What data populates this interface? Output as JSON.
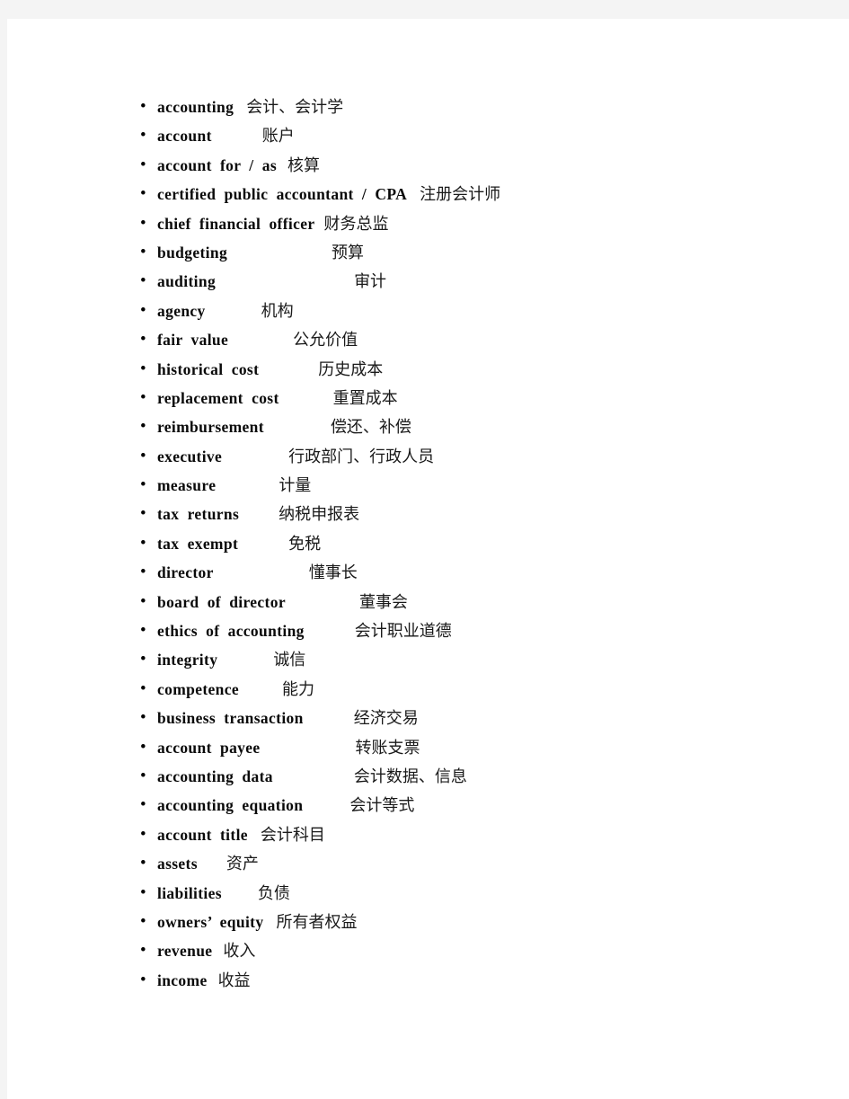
{
  "page": {
    "background_color": "#f4f4f4",
    "sheet_color": "#ffffff",
    "bullet_glyph": "•"
  },
  "glossary": {
    "items": [
      {
        "en": "accounting",
        "zh": "会计、会计学",
        "gap": 14
      },
      {
        "en": "account",
        "zh": "账户",
        "gap": 56
      },
      {
        "en": "account for / as",
        "zh": "核算",
        "gap": 12
      },
      {
        "en": "certified public accountant / CPA",
        "zh": "注册会计师",
        "gap": 14
      },
      {
        "en": "chief financial officer",
        "zh": "财务总监",
        "gap": 10
      },
      {
        "en": "budgeting",
        "zh": "预算",
        "gap": 116
      },
      {
        "en": "auditing",
        "zh": "审计",
        "gap": 154
      },
      {
        "en": "agency",
        "zh": "机构",
        "gap": 62
      },
      {
        "en": "fair value",
        "zh": "公允价值",
        "gap": 72
      },
      {
        "en": "historical cost",
        "zh": "历史成本",
        "gap": 66
      },
      {
        "en": "replacement cost",
        "zh": "重置成本",
        "gap": 60
      },
      {
        "en": "reimbursement",
        "zh": "偿还、补偿",
        "gap": 74
      },
      {
        "en": "executive",
        "zh": "行政部门、行政人员",
        "gap": 74
      },
      {
        "en": "measure",
        "zh": "计量",
        "gap": 70
      },
      {
        "en": "tax returns",
        "zh": "纳税申报表",
        "gap": 44
      },
      {
        "en": "tax exempt",
        "zh": "免税",
        "gap": 56
      },
      {
        "en": "director",
        "zh": "懂事长",
        "gap": 106
      },
      {
        "en": "board of director",
        "zh": "董事会",
        "gap": 82
      },
      {
        "en": "ethics of accounting",
        "zh": "会计职业道德",
        "gap": 56
      },
      {
        "en": "integrity",
        "zh": "诚信",
        "gap": 62
      },
      {
        "en": "competence",
        "zh": "能力",
        "gap": 48
      },
      {
        "en": "business transaction",
        "zh": "经济交易",
        "gap": 56
      },
      {
        "en": "account payee",
        "zh": "转账支票",
        "gap": 106
      },
      {
        "en": "accounting data",
        "zh": "会计数据、信息",
        "gap": 90
      },
      {
        "en": "accounting equation",
        "zh": "会计等式",
        "gap": 52
      },
      {
        "en": "account title",
        "zh": "会计科目",
        "gap": 14
      },
      {
        "en": "assets",
        "zh": "资产",
        "gap": 32
      },
      {
        "en": "liabilities",
        "zh": "负债",
        "gap": 40
      },
      {
        "en": "owners’ equity",
        "zh": "所有者权益",
        "gap": 14
      },
      {
        "en": "revenue",
        "zh": "收入",
        "gap": 12
      },
      {
        "en": "income",
        "zh": "收益",
        "gap": 12
      }
    ]
  }
}
